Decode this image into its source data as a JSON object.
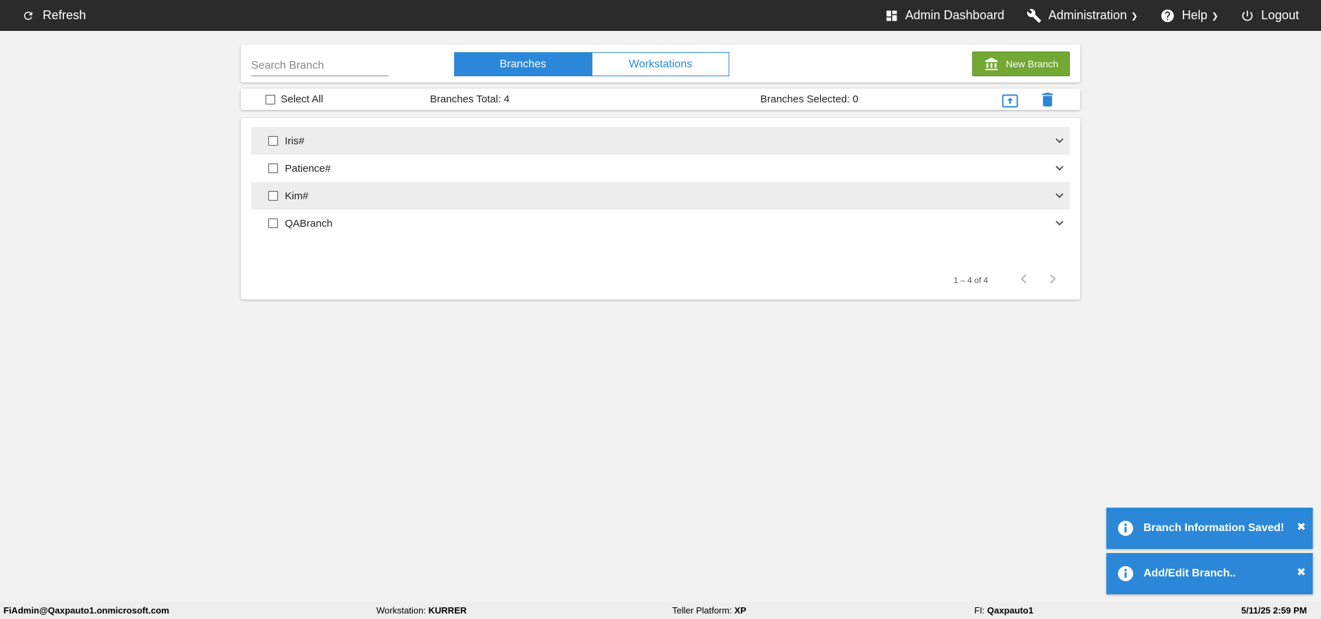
{
  "topbar": {
    "refresh_label": "Refresh",
    "admin_dashboard_label": "Admin Dashboard",
    "administration_label": "Administration",
    "help_label": "Help",
    "logout_label": "Logout"
  },
  "search": {
    "placeholder": "Search Branch",
    "value": ""
  },
  "tabs": [
    {
      "label": "Branches",
      "active": true
    },
    {
      "label": "Workstations",
      "active": false
    }
  ],
  "new_branch_label": "New Branch",
  "select_bar": {
    "select_all_label": "Select All",
    "total_label": "Branches Total: 4",
    "selected_label": "Branches Selected: 0"
  },
  "branches": [
    {
      "name": "Iris#"
    },
    {
      "name": "Patience#"
    },
    {
      "name": "Kim#"
    },
    {
      "name": "QABranch"
    }
  ],
  "pagination": {
    "range_label": "1 – 4 of 4"
  },
  "toasts": [
    {
      "message": "Branch Information Saved!"
    },
    {
      "message": "Add/Edit Branch.."
    }
  ],
  "status": {
    "user": "FiAdmin@Qaxpauto1.onmicrosoft.com",
    "workstation_label": "Workstation:",
    "workstation_value": "KURRER",
    "platform_label": "Teller Platform:",
    "platform_value": "XP",
    "fi_label": "FI:",
    "fi_value": "Qaxpauto1",
    "datetime": "5/11/25 2:59 PM"
  },
  "colors": {
    "accent": "#2b88d8",
    "new_branch_green": "#72a833",
    "topbar": "#2b2b2b"
  }
}
